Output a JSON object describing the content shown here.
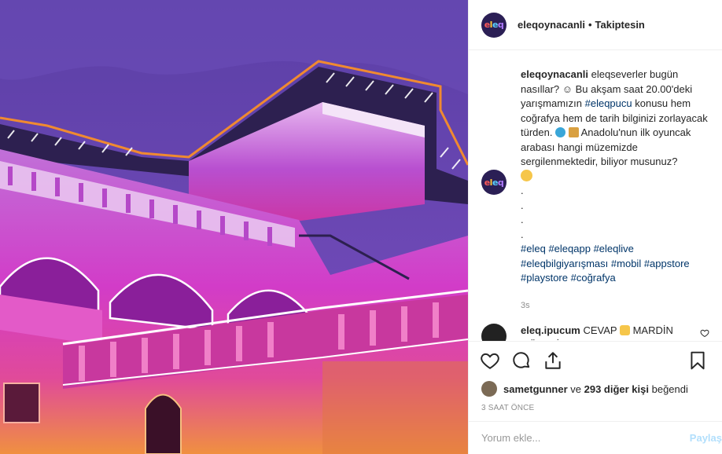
{
  "post": {
    "username": "eleqoynacanli",
    "separator": "•",
    "follow_status": "Takiptesin",
    "avatar_text": "eleq"
  },
  "caption": {
    "username": "eleqoynacanli",
    "text_1": " eleqseverler bugün nasıllar? ☺ Bu akşam saat 20.00'deki yarışmamızın ",
    "tag_1": "#eleqpucu",
    "text_2": " konusu hem coğrafya hem de tarih bilginizi zorlayacak türden. ",
    "text_3": " Anadolu'nun ilk oyuncak arabası hangi müzemizde sergilenmektedir, biliyor musunuz?",
    "dots": [
      ".",
      ".",
      ".",
      "."
    ],
    "hashtags": [
      "#eleq",
      "#eleqapp",
      "#eleqlive",
      "#eleqbilgiyarışması",
      "#mobil",
      "#appstore",
      "#playstore",
      "#coğrafya"
    ],
    "age": "3s"
  },
  "reply": {
    "username": "eleq.ipucum",
    "text_1": " CEVAP ",
    "text_2": " MARDİN MÜZESİ"
  },
  "likes": {
    "liker": "sametgunner",
    "middle": " ve ",
    "count": "293 diğer kişi",
    "suffix": " beğendi"
  },
  "timestamp": "3 SAAT ÖNCE",
  "comment_box": {
    "placeholder": "Yorum ekle...",
    "post_label": "Paylaş"
  },
  "colors": {
    "accent_link": "#003569",
    "post_disabled": "#b2dffc",
    "avatar_bg": "#2b1f55"
  },
  "icons": [
    "heart-icon",
    "comment-icon",
    "share-icon",
    "bookmark-icon"
  ]
}
